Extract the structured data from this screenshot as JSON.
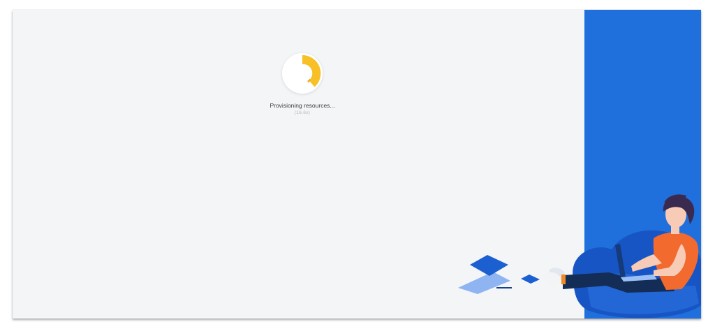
{
  "loader": {
    "status_text": "Provisioning resources...",
    "elapsed_text": "(16.6s)",
    "progress_fraction": 0.4
  },
  "colors": {
    "page_background": "#f3f5f7",
    "panel_blue": "#1f6fdd",
    "spinner_yellow": "#f6c026",
    "spinner_orange": "#f2a91e"
  },
  "illustration": {
    "description_icon": "person-on-beanbag-with-laptop-illustration"
  }
}
